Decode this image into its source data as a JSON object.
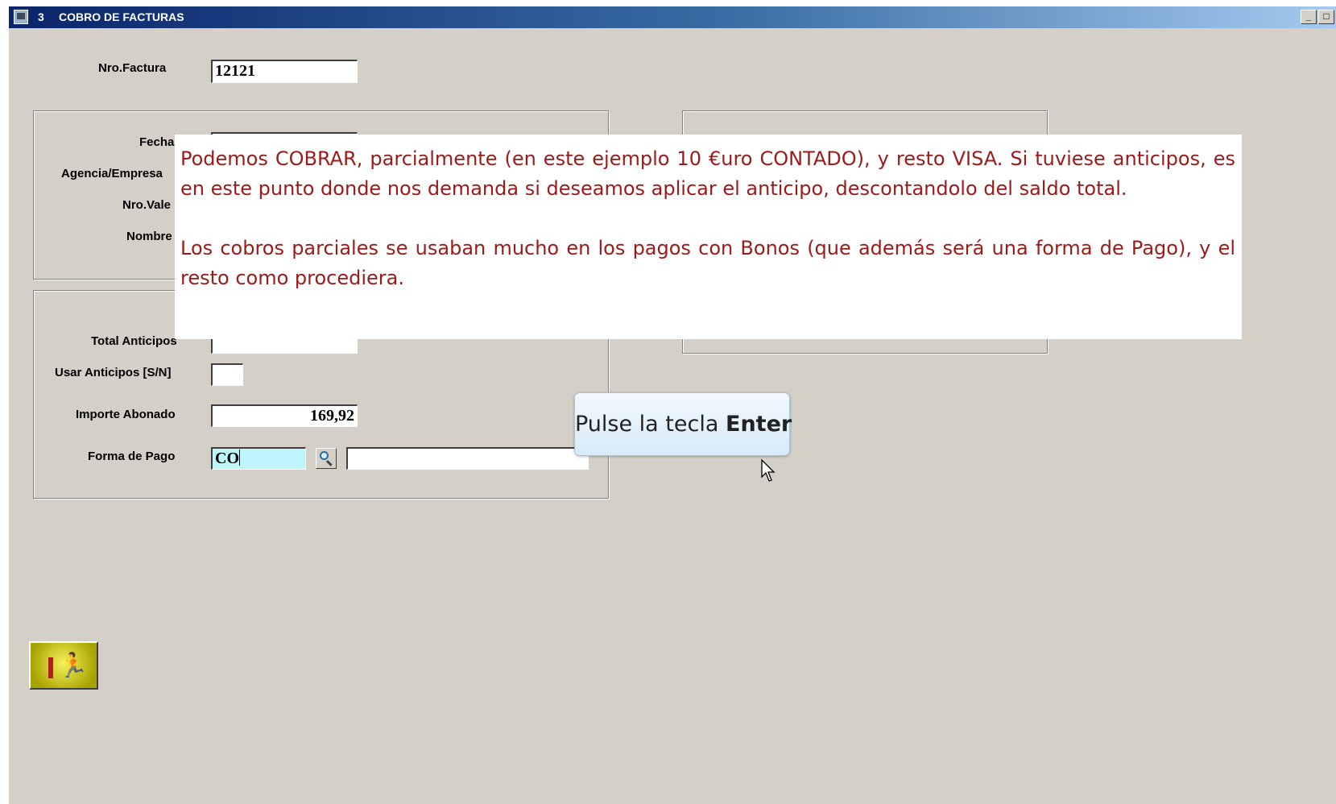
{
  "window": {
    "number": "3",
    "title": "COBRO DE FACTURAS",
    "controls": {
      "minimize": "_",
      "maximize": "□"
    }
  },
  "form": {
    "nro_factura": {
      "label": "Nro.Factura",
      "value": "12121"
    },
    "fecha": {
      "label": "Fecha"
    },
    "agencia_empresa": {
      "label": "Agencia/Empresa"
    },
    "nro_vale": {
      "label": "Nro.Vale"
    },
    "nombre": {
      "label": "Nombre"
    },
    "total_anticipos": {
      "label": "Total Anticipos",
      "value": ""
    },
    "usar_anticipos": {
      "label": "Usar Anticipos [S/N]",
      "value": ""
    },
    "importe_abonado": {
      "label": "Importe Abonado",
      "value": "169,92"
    },
    "forma_de_pago": {
      "label": "Forma de Pago",
      "value": "CO",
      "description": ""
    }
  },
  "tooltip": {
    "paragraph1": "Podemos COBRAR, parcialmente (en este ejemplo 10 €uro CONTADO), y resto VISA. Si tuviese anticipos, es en este punto donde nos demanda si deseamos aplicar el anticipo, descontandolo del saldo total.",
    "paragraph2": "Los cobros parciales se usaban mucho en los pagos con Bonos (que además será una forma de Pago), y el resto como procediera."
  },
  "hint": {
    "prefix": "Pulse la tecla",
    "key": "Enter"
  },
  "icons": {
    "exit": "exit-door-runner-icon",
    "search": "magnifier-icon",
    "window": "app-window-icon"
  },
  "colors": {
    "title_bar_start": "#0a246a",
    "window_bg": "#d4d0c8",
    "tooltip_text": "#9b1a1a",
    "active_field": "#bff6fb"
  }
}
